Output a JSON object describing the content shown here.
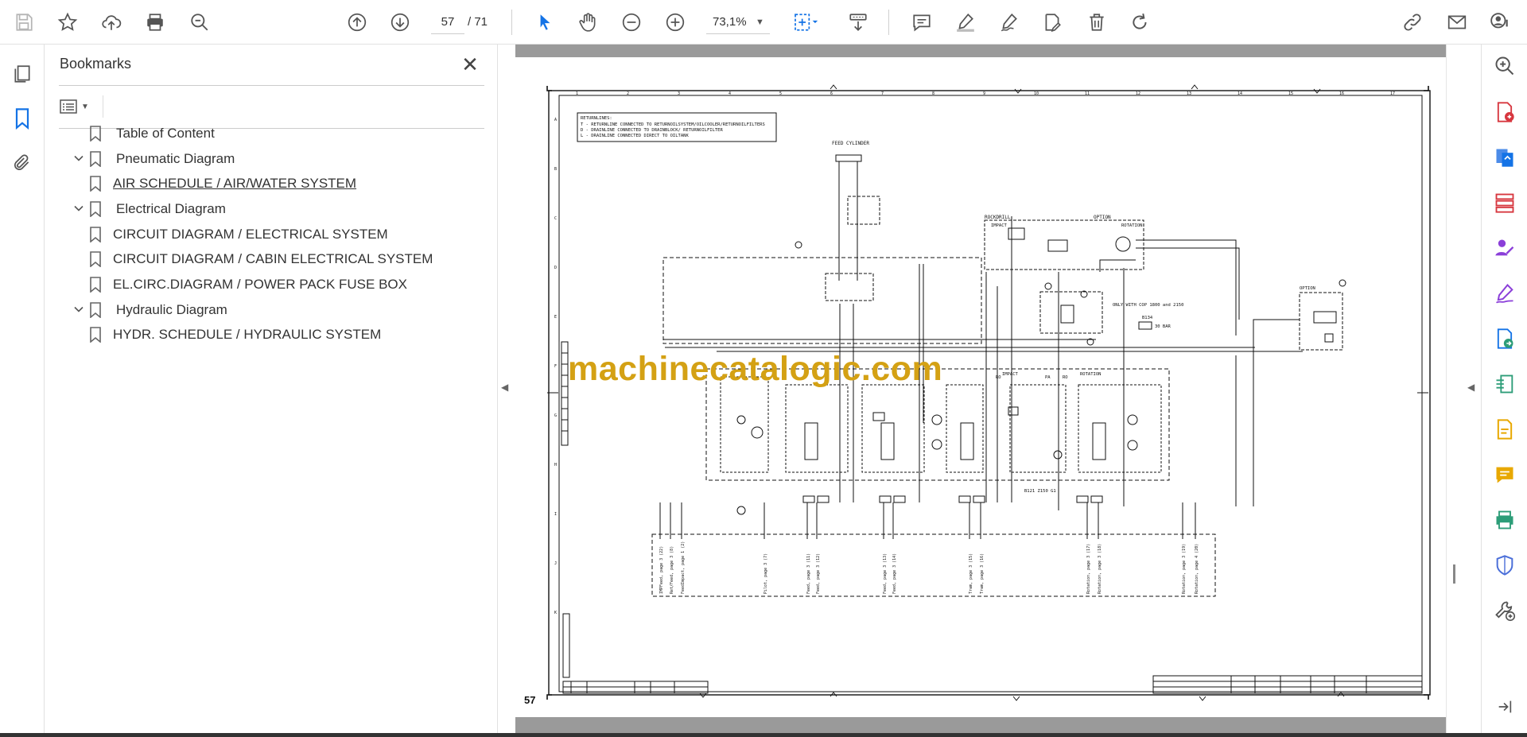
{
  "toolbar": {
    "page_current": "57",
    "page_total": "/ 71",
    "zoom": "73,1%",
    "icons": [
      "save-icon",
      "star-icon",
      "upload-icon",
      "print-icon",
      "search-zoom-icon",
      "page-up-icon",
      "page-down-icon",
      "select-arrow-icon",
      "hand-icon",
      "zoom-out-icon",
      "zoom-in-icon",
      "fit-page-icon",
      "scroll-mode-icon",
      "comment-icon",
      "highlight-icon",
      "draw-icon",
      "stamp-icon",
      "delete-icon",
      "redo-icon",
      "link-icon",
      "mail-icon",
      "account-help-icon"
    ]
  },
  "left_rail": {
    "icons": [
      "pages-icon",
      "bookmarks-icon",
      "attachments-icon"
    ]
  },
  "bookmarks": {
    "title": "Bookmarks",
    "items": [
      {
        "label": "Table of Content",
        "level": 0,
        "expandable": false,
        "linked": false
      },
      {
        "label": "Pneumatic Diagram",
        "level": 0,
        "expandable": true,
        "linked": false
      },
      {
        "label": "AIR SCHEDULE / AIR/WATER SYSTEM",
        "level": 1,
        "expandable": false,
        "linked": true
      },
      {
        "label": "Electrical Diagram",
        "level": 0,
        "expandable": true,
        "linked": false
      },
      {
        "label": "CIRCUIT DIAGRAM / ELECTRICAL SYSTEM",
        "level": 1,
        "expandable": false,
        "linked": false
      },
      {
        "label": "CIRCUIT DIAGRAM / CABIN ELECTRICAL SYSTEM",
        "level": 1,
        "expandable": false,
        "linked": false
      },
      {
        "label": "EL.CIRC.DIAGRAM / POWER PACK FUSE BOX",
        "level": 1,
        "expandable": false,
        "linked": false
      },
      {
        "label": "Hydraulic Diagram",
        "level": 0,
        "expandable": true,
        "linked": false
      },
      {
        "label": "HYDR. SCHEDULE / HYDRAULIC SYSTEM",
        "level": 1,
        "expandable": false,
        "linked": false
      }
    ]
  },
  "document": {
    "page_number_label": "57",
    "watermark": "machinecatalogic.com",
    "legend_lines": [
      "RETURNLINES:",
      "T - RETURNLINE CONNECTED TO RETURNOILSYSTEM/OILCOOLER/RETURNOILFILTERS",
      "D - DRAINLINE CONNECTED TO DRAINBLOCK/ RETURNOILFILTER",
      "L - DRAINLINE CONNECTED DIRECT TO OILTANK"
    ],
    "labels": {
      "feed_cylinder": "FEED CYLINDER",
      "rockdrill": "ROCKDRILL",
      "impact": "IMPACT",
      "option": "OPTION",
      "rotation": "ROTATION",
      "cop_note": "ONLY WITH COP 1800 and 2150",
      "b134": "B134",
      "bar": "30 BAR",
      "b121": "B121  Z150 G1",
      "ro": "RO",
      "ro2": "RO",
      "pa": "PA",
      "option2": "OPTION"
    },
    "bottom_ports": [
      "IMPFeed, page 3 (22)",
      "Ret/Feed, page 3 (8)",
      "FeedImpact, page 1 (2)",
      "Pilot, page 3 (7)",
      "Feed, page 3 (11)",
      "Feed, page 3 (12)",
      "Feed, page 3 (13)",
      "Feed, page 3 (14)",
      "Tram, page 3 (15)",
      "Tram, page 3 (16)",
      "Rotation, page 3 (17)",
      "Rotation, page 3 (18)",
      "Rotation, page 3 (19)",
      "Rotation, page 4 (20)"
    ],
    "col_numbers": [
      "1",
      "2",
      "3",
      "4",
      "5",
      "6",
      "7",
      "8",
      "9",
      "10",
      "11",
      "12",
      "13",
      "14",
      "15",
      "16",
      "17"
    ],
    "row_letters": [
      "A",
      "B",
      "C",
      "D",
      "E",
      "F",
      "G",
      "H",
      "I",
      "J",
      "K"
    ]
  },
  "right_rail": {
    "icons": [
      "zoom-search-icon",
      "export-pdf-icon",
      "create-pdf-icon",
      "organize-pages-icon",
      "request-signature-icon",
      "fill-sign-icon",
      "send-review-icon",
      "compress-icon",
      "edit-pdf-icon",
      "comment-icon",
      "print-production-icon",
      "protect-icon",
      "more-tools-icon",
      "expand-panel-icon"
    ]
  },
  "colors": {
    "accent_blue": "#1473e6",
    "rail_red": "#d7373f",
    "rail_purple": "#8b3fd9",
    "rail_green": "#2d9d78",
    "rail_yellow": "#e8a800",
    "watermark": "#d4a114"
  }
}
